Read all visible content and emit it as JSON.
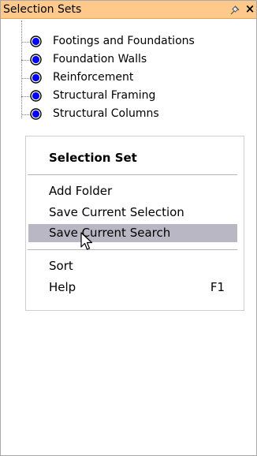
{
  "panel": {
    "title": "Selection Sets",
    "close_glyph": "×",
    "pin_icon": "pin-icon",
    "close_icon": "close-icon",
    "title_bg": "#ffc98c"
  },
  "tree": {
    "items": [
      {
        "label": "Footings and Foundations",
        "icon": "selection-set-icon"
      },
      {
        "label": "Foundation Walls",
        "icon": "selection-set-icon"
      },
      {
        "label": "Reinforcement",
        "icon": "selection-set-icon"
      },
      {
        "label": "Structural Framing",
        "icon": "selection-set-icon"
      },
      {
        "label": "Structural Columns",
        "icon": "selection-set-icon"
      }
    ],
    "icon_color": "#0000ff"
  },
  "context_menu": {
    "header": "Selection Set",
    "items": [
      {
        "label": "Add Folder",
        "shortcut": ""
      },
      {
        "label": "Save Current Selection",
        "shortcut": ""
      },
      {
        "label": "Save Current Search",
        "shortcut": "",
        "highlighted": true
      },
      {
        "label": "Sort",
        "shortcut": ""
      },
      {
        "label": "Help",
        "shortcut": "F1"
      }
    ],
    "highlight_color": "#bab7c4"
  }
}
